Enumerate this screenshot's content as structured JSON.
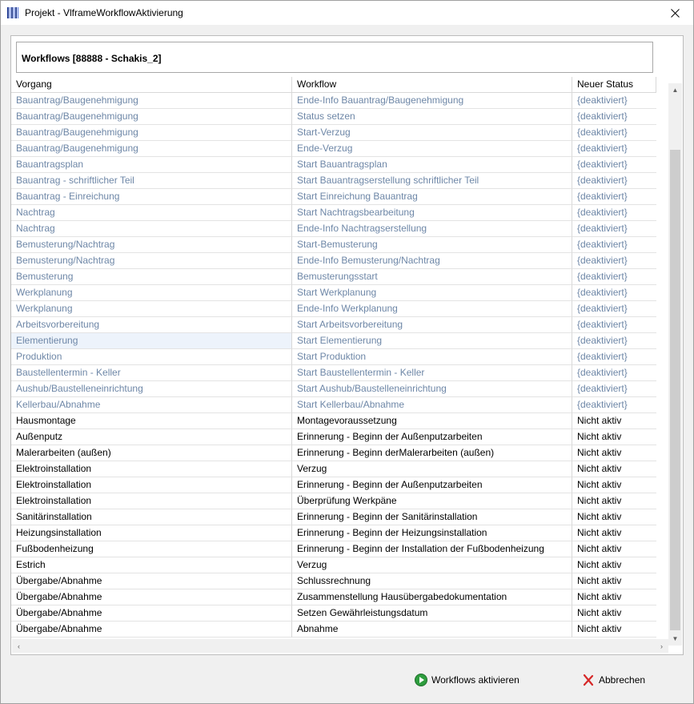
{
  "window": {
    "title": "Projekt - VlframeWorkflowAktivierung"
  },
  "header": {
    "title": "Workflows [88888 - Schakis_2]"
  },
  "table": {
    "columns": [
      "Vorgang",
      "Workflow",
      "Neuer Status"
    ],
    "rows": [
      {
        "vorgang": "Bauantrag/Baugenehmigung",
        "workflow": "Ende-Info Bauantrag/Baugenehmigung",
        "status": "{deaktiviert}",
        "state": "inactive"
      },
      {
        "vorgang": "Bauantrag/Baugenehmigung",
        "workflow": "Status setzen",
        "status": "{deaktiviert}",
        "state": "inactive"
      },
      {
        "vorgang": "Bauantrag/Baugenehmigung",
        "workflow": "Start-Verzug",
        "status": "{deaktiviert}",
        "state": "inactive"
      },
      {
        "vorgang": "Bauantrag/Baugenehmigung",
        "workflow": "Ende-Verzug",
        "status": "{deaktiviert}",
        "state": "inactive"
      },
      {
        "vorgang": "Bauantragsplan",
        "workflow": "Start Bauantragsplan",
        "status": "{deaktiviert}",
        "state": "inactive"
      },
      {
        "vorgang": "Bauantrag - schriftlicher Teil",
        "workflow": "Start Bauantragserstellung schriftlicher Teil",
        "status": "{deaktiviert}",
        "state": "inactive"
      },
      {
        "vorgang": "Bauantrag - Einreichung",
        "workflow": "Start Einreichung Bauantrag",
        "status": "{deaktiviert}",
        "state": "inactive"
      },
      {
        "vorgang": "Nachtrag",
        "workflow": "Start Nachtragsbearbeitung",
        "status": "{deaktiviert}",
        "state": "inactive"
      },
      {
        "vorgang": "Nachtrag",
        "workflow": "Ende-Info Nachtragserstellung",
        "status": "{deaktiviert}",
        "state": "inactive"
      },
      {
        "vorgang": "Bemusterung/Nachtrag",
        "workflow": "Start-Bemusterung",
        "status": "{deaktiviert}",
        "state": "inactive"
      },
      {
        "vorgang": "Bemusterung/Nachtrag",
        "workflow": "Ende-Info Bemusterung/Nachtrag",
        "status": "{deaktiviert}",
        "state": "inactive"
      },
      {
        "vorgang": "Bemusterung",
        "workflow": "Bemusterungsstart",
        "status": "{deaktiviert}",
        "state": "inactive"
      },
      {
        "vorgang": "Werkplanung",
        "workflow": "Start Werkplanung",
        "status": "{deaktiviert}",
        "state": "inactive"
      },
      {
        "vorgang": "Werkplanung",
        "workflow": "Ende-Info Werkplanung",
        "status": "{deaktiviert}",
        "state": "inactive"
      },
      {
        "vorgang": "Arbeitsvorbereitung",
        "workflow": "Start Arbeitsvorbereitung",
        "status": "{deaktiviert}",
        "state": "inactive"
      },
      {
        "vorgang": "Elementierung",
        "workflow": "Start Elementierung",
        "status": "{deaktiviert}",
        "state": "inactive",
        "selected": true
      },
      {
        "vorgang": "Produktion",
        "workflow": "Start Produktion",
        "status": "{deaktiviert}",
        "state": "inactive"
      },
      {
        "vorgang": "Baustellentermin - Keller",
        "workflow": "Start Baustellentermin - Keller",
        "status": "{deaktiviert}",
        "state": "inactive"
      },
      {
        "vorgang": "Aushub/Baustelleneinrichtung",
        "workflow": "Start Aushub/Baustelleneinrichtung",
        "status": "{deaktiviert}",
        "state": "inactive"
      },
      {
        "vorgang": "Kellerbau/Abnahme",
        "workflow": "Start Kellerbau/Abnahme",
        "status": "{deaktiviert}",
        "state": "inactive"
      },
      {
        "vorgang": "Hausmontage",
        "workflow": "Montagevoraussetzung",
        "status": "Nicht aktiv",
        "state": "active"
      },
      {
        "vorgang": "Außenputz",
        "workflow": "Erinnerung - Beginn der Außenputzarbeiten",
        "status": "Nicht aktiv",
        "state": "active"
      },
      {
        "vorgang": "Malerarbeiten (außen)",
        "workflow": "Erinnerung - Beginn derMalerarbeiten (außen)",
        "status": "Nicht aktiv",
        "state": "active"
      },
      {
        "vorgang": "Elektroinstallation",
        "workflow": "Verzug",
        "status": "Nicht aktiv",
        "state": "active"
      },
      {
        "vorgang": "Elektroinstallation",
        "workflow": "Erinnerung - Beginn der Außenputzarbeiten",
        "status": "Nicht aktiv",
        "state": "active"
      },
      {
        "vorgang": "Elektroinstallation",
        "workflow": "Überprüfung Werkpäne",
        "status": "Nicht aktiv",
        "state": "active"
      },
      {
        "vorgang": "Sanitärinstallation",
        "workflow": "Erinnerung - Beginn der Sanitärinstallation",
        "status": "Nicht aktiv",
        "state": "active"
      },
      {
        "vorgang": "Heizungsinstallation",
        "workflow": "Erinnerung - Beginn der Heizungsinstallation",
        "status": "Nicht aktiv",
        "state": "active"
      },
      {
        "vorgang": "Fußbodenheizung",
        "workflow": "Erinnerung - Beginn der Installation der Fußbodenheizung",
        "status": "Nicht aktiv",
        "state": "active"
      },
      {
        "vorgang": "Estrich",
        "workflow": "Verzug",
        "status": "Nicht aktiv",
        "state": "active"
      },
      {
        "vorgang": "Übergabe/Abnahme",
        "workflow": "Schlussrechnung",
        "status": "Nicht aktiv",
        "state": "active"
      },
      {
        "vorgang": "Übergabe/Abnahme",
        "workflow": "Zusammenstellung Hausübergabedokumentation",
        "status": "Nicht aktiv",
        "state": "active"
      },
      {
        "vorgang": "Übergabe/Abnahme",
        "workflow": "Setzen Gewährleistungsdatum",
        "status": "Nicht aktiv",
        "state": "active"
      },
      {
        "vorgang": "Übergabe/Abnahme",
        "workflow": "Abnahme",
        "status": "Nicht aktiv",
        "state": "active"
      }
    ]
  },
  "buttons": {
    "activate_label": "Workflows aktivieren",
    "activate_icon": "play-circle-icon",
    "cancel_label": "Abbrechen",
    "cancel_icon": "red-x-icon"
  },
  "colors": {
    "inactive_text": "#6e87a7",
    "active_text": "#000000",
    "activate_icon": "#2e9d3e",
    "cancel_icon": "#d62828"
  }
}
